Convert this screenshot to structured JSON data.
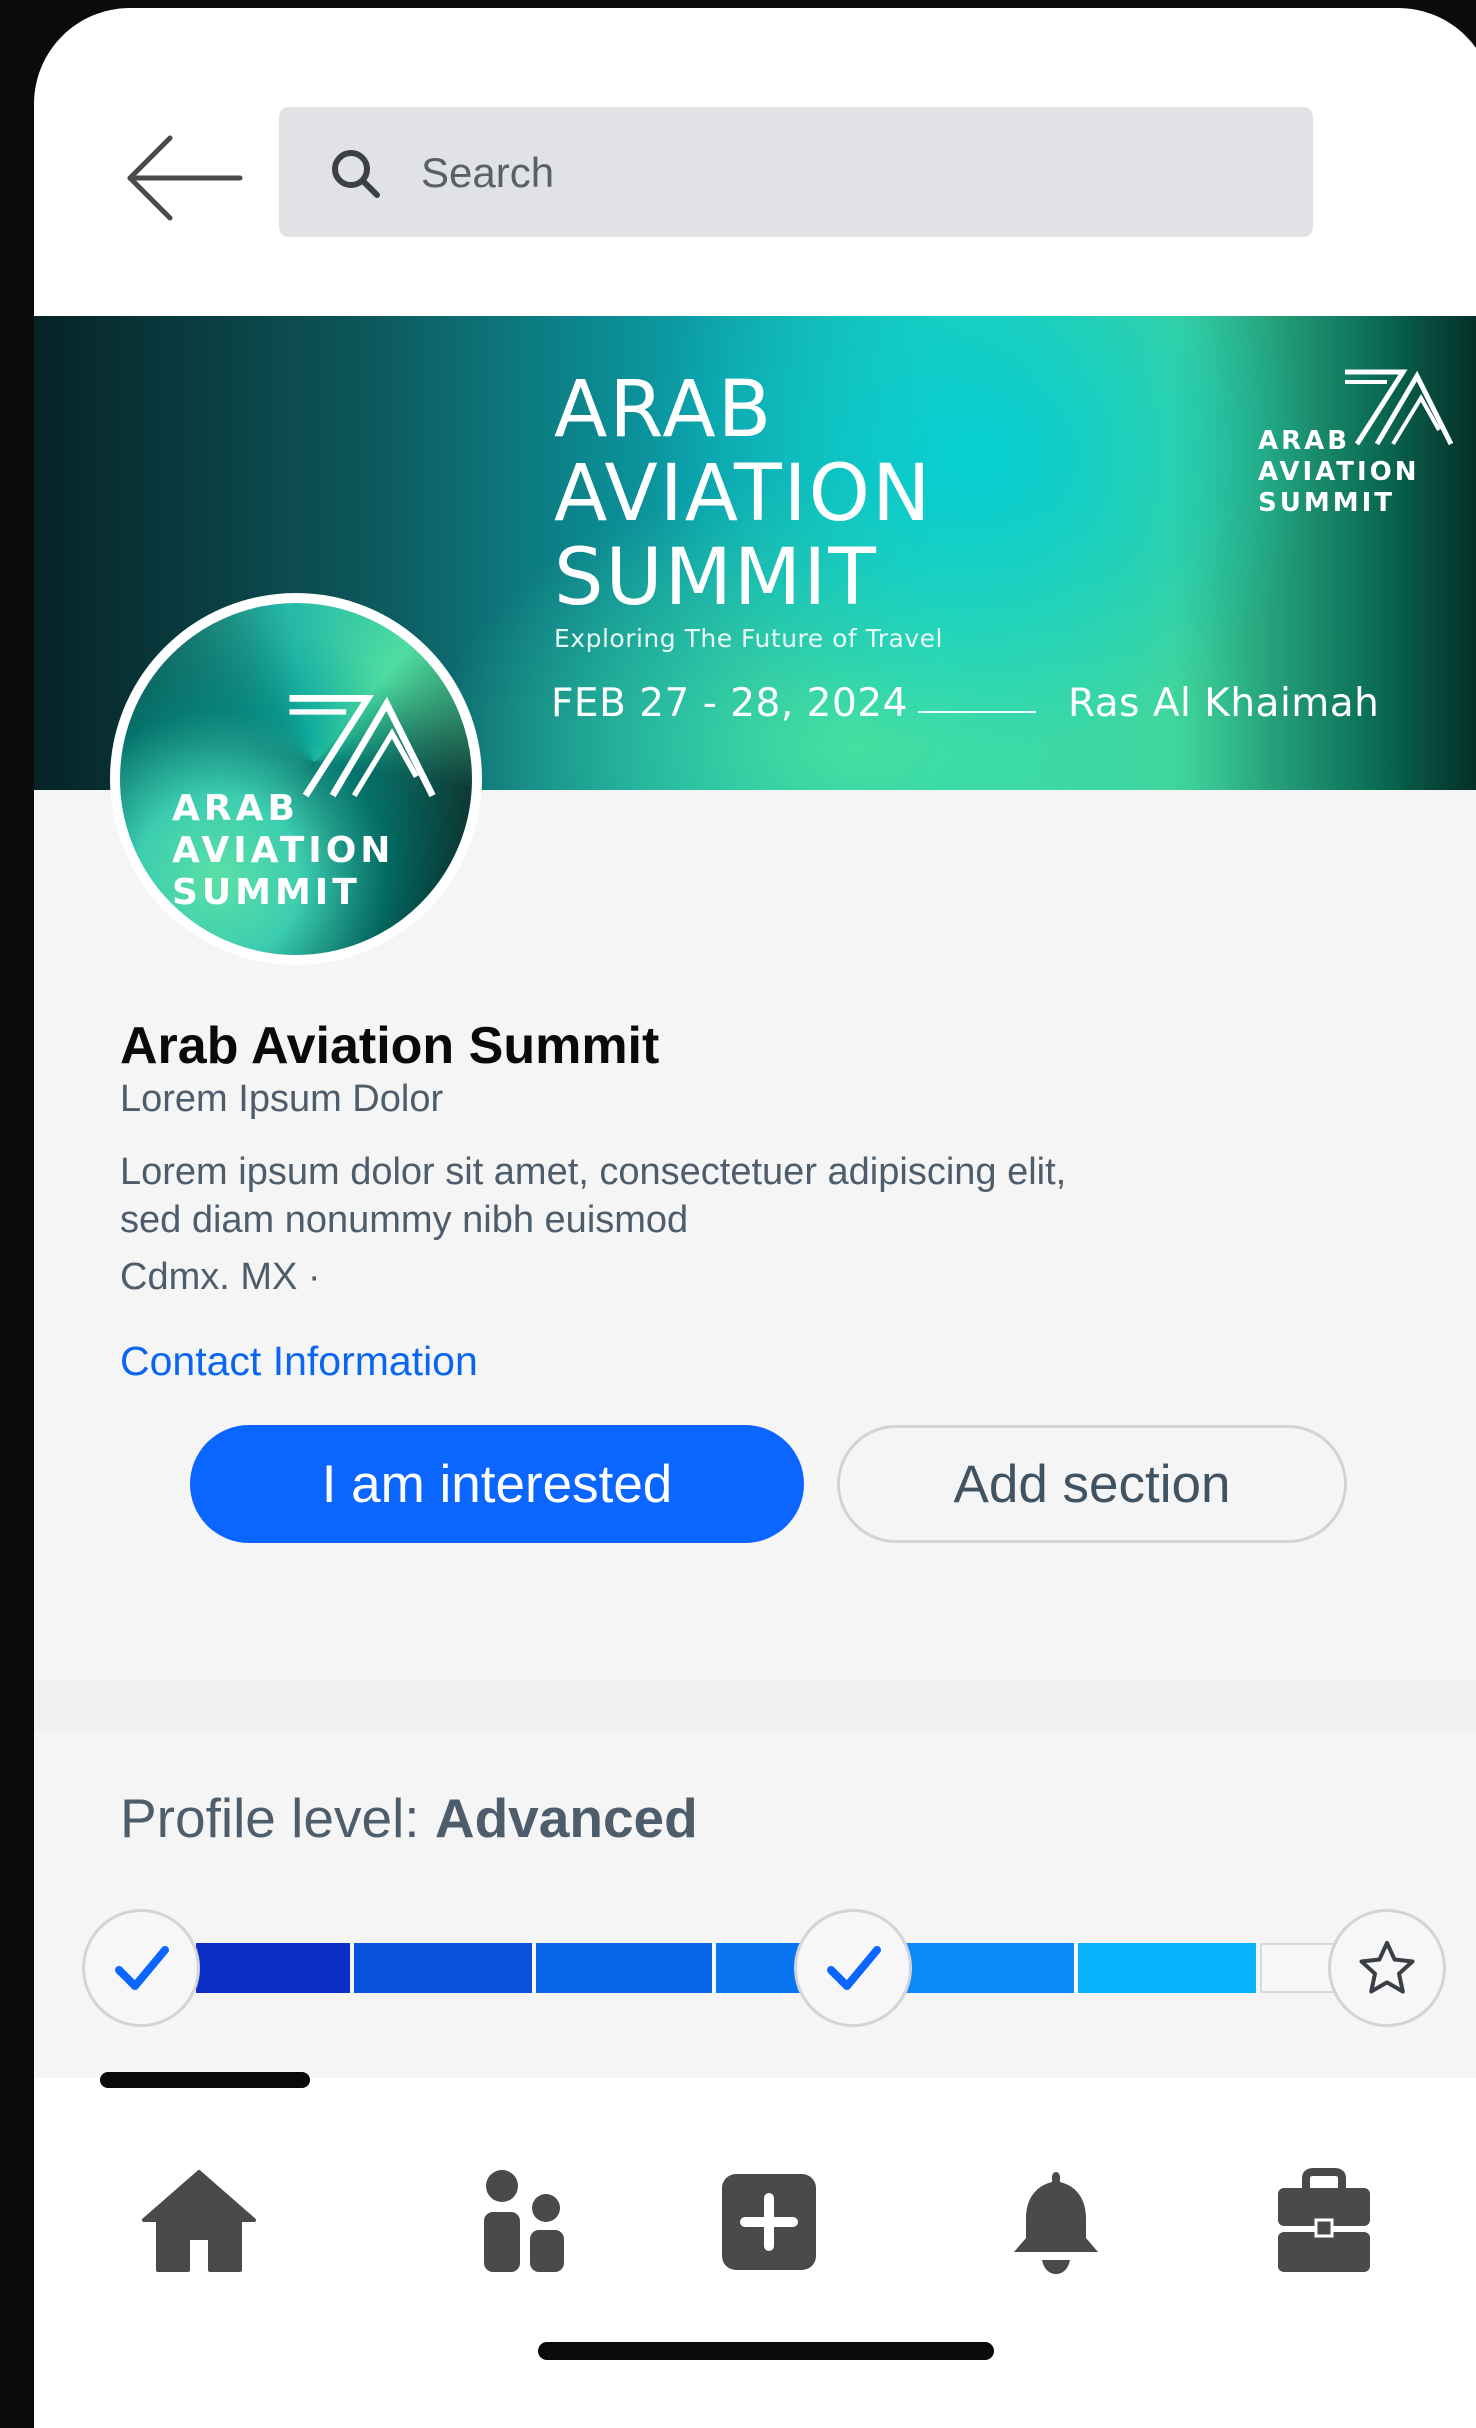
{
  "header": {
    "search_placeholder": "Search"
  },
  "banner": {
    "title_line1": "ARAB",
    "title_line2": "AVIATION",
    "title_line3": "SUMMIT",
    "tagline": "Exploring The Future of Travel",
    "date": "FEB 27 - 28, 2024",
    "location": "Ras Al Khaimah",
    "logo_line1": "ARAB",
    "logo_line2": "AVIATION",
    "logo_line3": "SUMMIT"
  },
  "avatar": {
    "line1": "ARAB",
    "line2": "AVIATION",
    "line3": "SUMMIT"
  },
  "profile": {
    "name": "Arab Aviation Summit",
    "subtitle": "Lorem Ipsum Dolor",
    "description": "Lorem ipsum dolor sit amet, consectetuer adipiscing elit, sed diam nonummy nibh euismod",
    "location": "Cdmx. MX ·",
    "contact_link": "Contact Information"
  },
  "actions": {
    "primary_label": "I am interested",
    "secondary_label": "Add section"
  },
  "profile_level": {
    "label": "Profile level: ",
    "value": "Advanced",
    "filled_segments": 6,
    "total_segments": 7,
    "milestones": [
      "completed",
      "completed",
      "pending"
    ]
  },
  "colors": {
    "accent": "#0a66ff",
    "text_secondary": "#4d5d6b",
    "segments": [
      "#0a2ec4",
      "#0a52dc",
      "#0a66e8",
      "#0a75f0",
      "#0a8af7",
      "#05b2fb",
      "#f7f7f7"
    ]
  },
  "bottom_nav": {
    "icons": [
      "home-icon",
      "people-icon",
      "add-post-icon",
      "notifications-bell-icon",
      "jobs-briefcase-icon"
    ]
  }
}
